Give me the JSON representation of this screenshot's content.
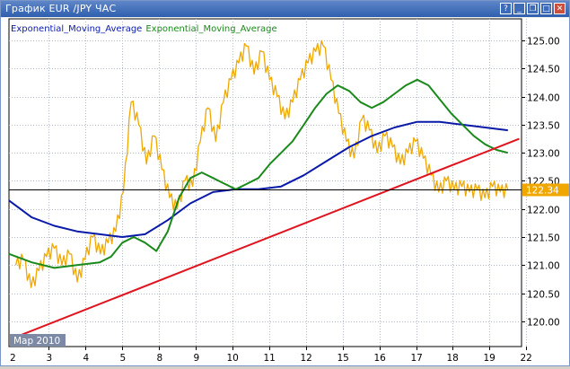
{
  "window": {
    "title": "График EUR /JPY  ЧАС",
    "buttons": [
      {
        "name": "help-button",
        "glyph": "?"
      },
      {
        "name": "minimize-button",
        "glyph": "_"
      },
      {
        "name": "restore-button",
        "glyph": "❐"
      },
      {
        "name": "maximize-button",
        "glyph": "□"
      },
      {
        "name": "close-button",
        "glyph": "✕"
      }
    ]
  },
  "legend": {
    "item1": "Exponential_Moving_Average",
    "item2": "Exponential_Moving_Average"
  },
  "colors": {
    "price": "#f0a800",
    "ema_fast": "#1a8a1a",
    "ema_slow": "#0a1aa8",
    "trendline": "#e0141e",
    "hline": "#000000",
    "price_tag_bg": "#f0a800",
    "grid": "#b0b8c8",
    "legend_blue": "#0a1aa8",
    "legend_green": "#1a8a1a"
  },
  "chart_data": {
    "type": "line",
    "y_ticks": [
      120.0,
      120.5,
      121.0,
      121.5,
      122.0,
      122.5,
      123.0,
      123.5,
      124.0,
      124.5,
      125.0
    ],
    "y_tick_labels": [
      "120.00",
      "120.50",
      "121.00",
      "121.50",
      "122.00",
      "122.50",
      "123.00",
      "123.50",
      "124.00",
      "124.50",
      "125.00"
    ],
    "ylim": [
      119.55,
      125.4
    ],
    "x_ticks": [
      "3",
      "4",
      "5",
      "8",
      "9",
      "10",
      "11",
      "12",
      "15",
      "16",
      "17",
      "18",
      "19",
      "22"
    ],
    "x_first_label": "2",
    "period_label": "Мар 2010",
    "current_price_label": "122.34",
    "current_price": 122.34,
    "grid": true,
    "series": [
      {
        "key": "price",
        "x": [
          0,
          0.3,
          0.6,
          0.9,
          1.2,
          1.5,
          1.8,
          2.1,
          2.4,
          2.7,
          3.0,
          3.3,
          3.6,
          3.9,
          4.2,
          4.5,
          4.8,
          5.1,
          5.4,
          5.7,
          6.0,
          6.3,
          6.6,
          6.9,
          7.2,
          7.5,
          7.8,
          8.1,
          8.4,
          8.7,
          9.0,
          9.3,
          9.6,
          9.9,
          10.2,
          10.5,
          10.8,
          11.1,
          11.4,
          11.7,
          12.0,
          12.3,
          12.6,
          12.9,
          13.2
        ],
        "values": [
          121.0,
          121.1,
          120.6,
          120.9,
          121.15,
          121.3,
          121.0,
          121.2,
          120.7,
          121.1,
          121.5,
          121.2,
          121.4,
          121.6,
          122.3,
          123.9,
          123.5,
          122.8,
          123.3,
          122.7,
          122.2,
          122.0,
          122.5,
          122.4,
          123.2,
          123.8,
          123.2,
          123.9,
          124.3,
          124.6,
          124.9,
          124.4,
          124.8,
          124.3,
          124.0,
          123.6,
          123.9,
          124.3,
          124.6,
          124.8,
          124.9,
          124.3,
          123.7,
          123.2,
          122.9
        ]
      },
      {
        "key": "price_tail",
        "x": [
          13.2,
          13.5,
          13.8,
          14.1,
          14.4,
          14.7,
          15.0,
          15.3,
          15.6,
          15.9,
          16.2,
          16.5,
          16.8,
          17.1,
          17.4,
          17.7,
          18.0,
          18.3,
          18.6,
          18.9,
          19.2
        ],
        "values": [
          122.9,
          123.6,
          123.4,
          123.0,
          123.3,
          123.1,
          122.8,
          123.0,
          123.2,
          122.9,
          122.6,
          122.3,
          122.5,
          122.34,
          122.4,
          122.3,
          122.34,
          122.2,
          122.4,
          122.3,
          122.34
        ]
      },
      {
        "key": "ema_fast",
        "x": [
          0,
          1,
          2,
          3,
          4,
          4.5,
          5,
          5.5,
          6,
          6.5,
          7,
          7.5,
          8,
          8.5,
          9,
          9.5,
          10,
          10.5,
          11,
          11.5,
          12,
          12.5,
          13,
          13.5,
          14,
          14.5,
          15,
          15.5,
          16,
          16.5,
          17,
          17.5,
          18,
          18.5,
          19,
          19.5,
          20,
          20.5,
          21,
          21.5,
          22
        ],
        "values": [
          121.2,
          121.05,
          120.95,
          121.0,
          121.05,
          121.15,
          121.4,
          121.5,
          121.4,
          121.25,
          121.6,
          122.2,
          122.55,
          122.65,
          122.55,
          122.45,
          122.35,
          122.45,
          122.55,
          122.8,
          123.0,
          123.2,
          123.5,
          123.8,
          124.05,
          124.2,
          124.1,
          123.9,
          123.8,
          123.9,
          124.05,
          124.2,
          124.3,
          124.2,
          123.95,
          123.7,
          123.5,
          123.3,
          123.15,
          123.05,
          123.0
        ]
      },
      {
        "key": "ema_slow",
        "x": [
          0,
          1,
          2,
          3,
          4,
          5,
          6,
          7,
          8,
          9,
          10,
          11,
          12,
          13,
          14,
          15,
          16,
          17,
          18,
          19,
          20,
          21,
          22
        ],
        "values": [
          122.15,
          121.85,
          121.7,
          121.6,
          121.55,
          121.5,
          121.55,
          121.8,
          122.1,
          122.3,
          122.35,
          122.35,
          122.4,
          122.6,
          122.85,
          123.1,
          123.3,
          123.45,
          123.55,
          123.55,
          123.5,
          123.45,
          123.4
        ]
      },
      {
        "key": "trendline",
        "x": [
          0.5,
          22.5
        ],
        "values": [
          119.75,
          123.25
        ]
      }
    ]
  }
}
